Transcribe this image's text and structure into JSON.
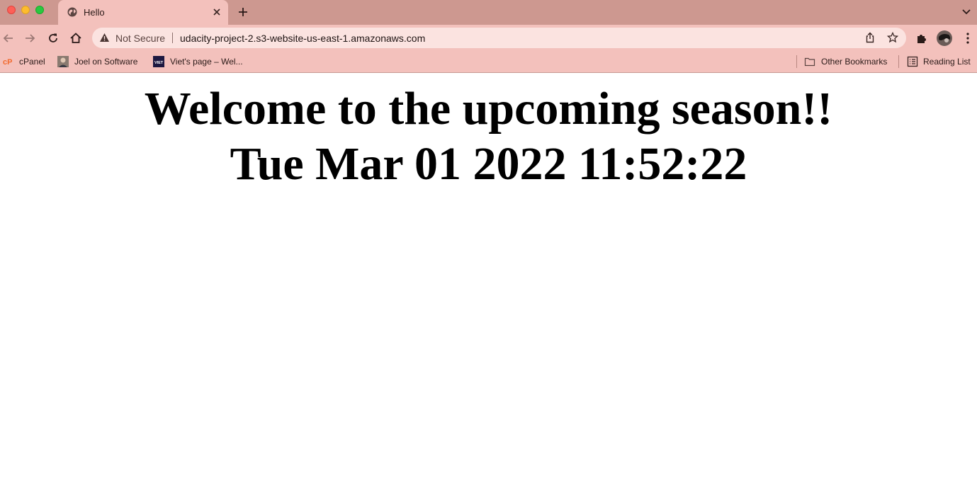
{
  "browser": {
    "tab": {
      "title": "Hello",
      "favicon": "globe-icon"
    },
    "address": {
      "security_label": "Not Secure",
      "url": "udacity-project-2.s3-website-us-east-1.amazonaws.com"
    },
    "bookmarks": [
      {
        "label": "cPanel",
        "icon": "cpanel-icon"
      },
      {
        "label": "Joel on Software",
        "icon": "avatar-icon"
      },
      {
        "label": "Viet's page – Wel...",
        "icon": "viet-icon"
      }
    ],
    "other_bookmarks": "Other Bookmarks",
    "reading_list": "Reading List",
    "colors": {
      "frame": "#cd9890",
      "toolbar": "#f3c1bc",
      "omnibox": "#fbe3e0"
    }
  },
  "page": {
    "headline": "Welcome to the upcoming season!!",
    "datetime": "Tue Mar 01 2022 11:52:22"
  }
}
